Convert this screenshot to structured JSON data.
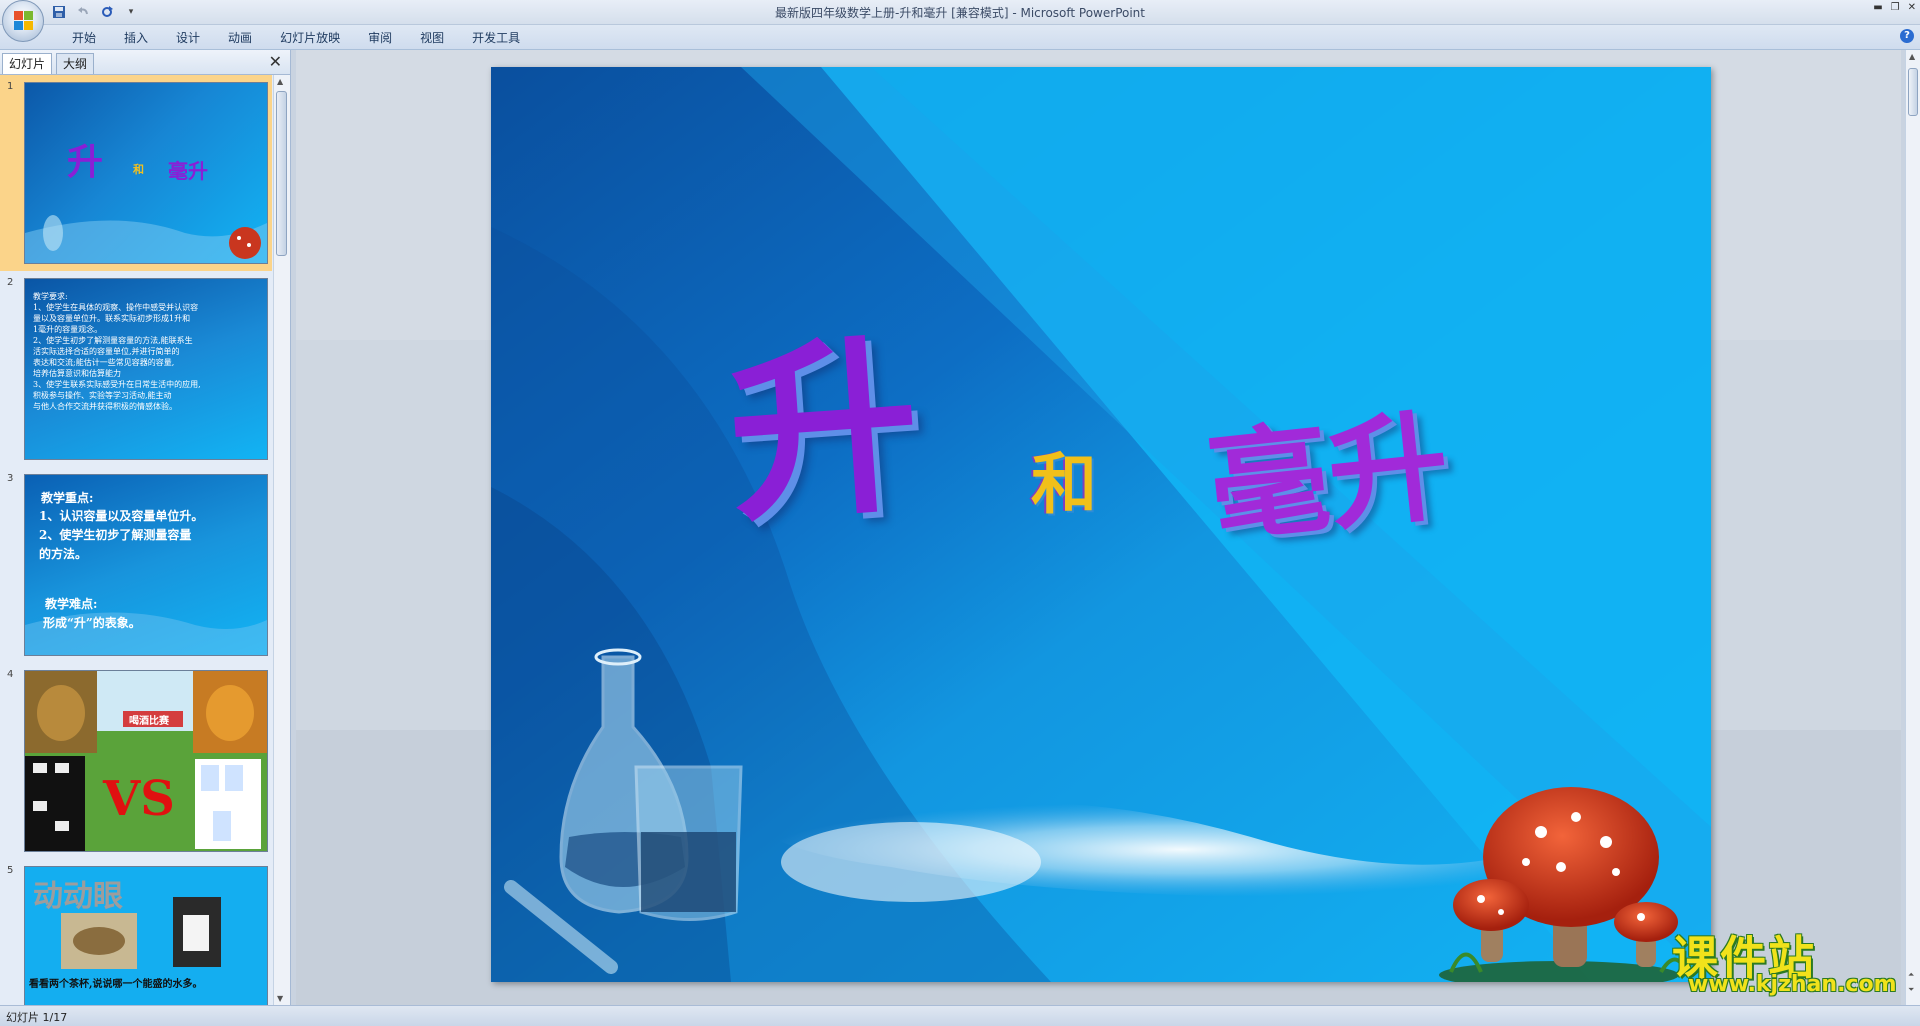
{
  "window": {
    "title": "最新版四年级数学上册-升和毫升 [兼容模式] - Microsoft PowerPoint"
  },
  "ribbon": {
    "tabs": [
      "开始",
      "插入",
      "设计",
      "动画",
      "幻灯片放映",
      "审阅",
      "视图",
      "开发工具"
    ]
  },
  "panel": {
    "tab_slides": "幻灯片",
    "tab_outline": "大纲",
    "thumbnails": [
      {
        "number": "1",
        "title_chars": [
          "升",
          "和",
          "毫升"
        ]
      },
      {
        "number": "2",
        "lines": [
          "教学要求:",
          "1、使学生在具体的观察、操作中感受并认识容",
          "   量以及容量单位升。联系实际初步形成1升和",
          "   1毫升的容量观念。",
          "2、使学生初步了解测量容量的方法,能联系生",
          "   活实际选择合适的容量单位,并进行简单的",
          "   表达和交流;能估计一些常见容器的容量,",
          "   培养估算意识和估算能力",
          "3、使学生联系实际感受升在日常生活中的应用,",
          "   积极参与操作、实验等学习活动,能主动",
          "   与他人合作交流并获得积极的情感体验。"
        ]
      },
      {
        "number": "3",
        "lines": [
          "教学重点:",
          "1、认识容量以及容量单位升。",
          "2、使学生初步了解测量容量",
          "   的方法。",
          "教学难点:",
          "形成“升”的表象。"
        ]
      },
      {
        "number": "4",
        "vs": "VS",
        "banner": "喝酒比赛"
      },
      {
        "number": "5",
        "heading": "动动眼",
        "caption": "看看两个茶杯,说说哪一个能盛的水多。"
      }
    ]
  },
  "slide": {
    "char_sheng": "升",
    "char_he": "和",
    "char_haosheng": "毫升"
  },
  "status": {
    "slide_counter": "幻灯片 1/17"
  },
  "watermark": {
    "main": "课件站",
    "url": "www.kjzhan.com"
  },
  "colors": {
    "slide_blue_light": "#12b4f4",
    "slide_blue_dark": "#0a5db0",
    "title_purple": "#8a1fd6",
    "thumb_selected": "#fbd48a"
  }
}
